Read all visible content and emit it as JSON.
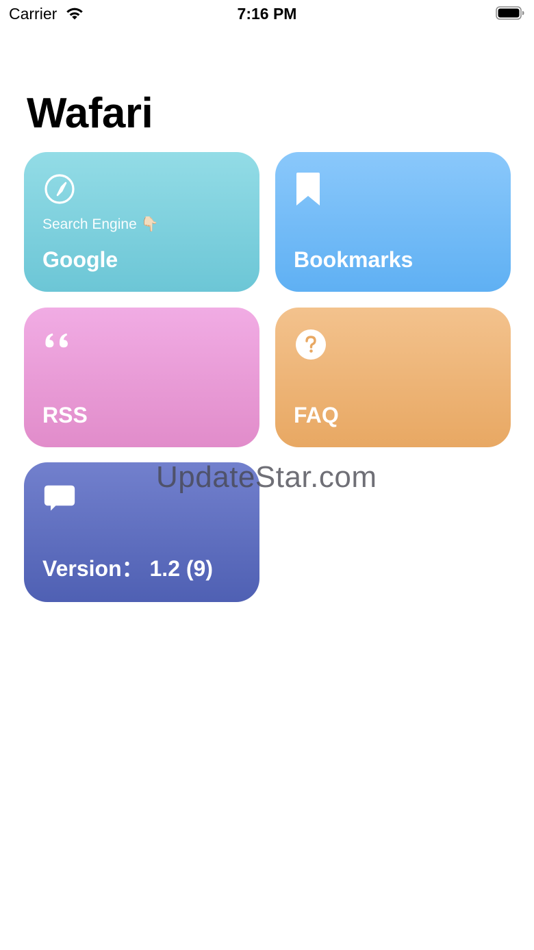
{
  "status_bar": {
    "carrier": "Carrier",
    "time": "7:16 PM",
    "wifi_icon": "wifi-icon",
    "battery_icon": "battery-icon"
  },
  "page": {
    "title": "Wafari"
  },
  "cards": {
    "google": {
      "icon": "compass-icon",
      "subtitle": "Search Engine 👇🏻",
      "label": "Google",
      "color_top": "#93dce6",
      "color_bottom": "#6cc6d6"
    },
    "bookmarks": {
      "icon": "bookmark-icon",
      "label": "Bookmarks",
      "color_top": "#8ac8fb",
      "color_bottom": "#5fb0f3"
    },
    "rss": {
      "icon": "quote-icon",
      "label": "RSS",
      "color_top": "#f1ace4",
      "color_bottom": "#e18cca"
    },
    "faq": {
      "icon": "question-circle-icon",
      "label": "FAQ",
      "color_top": "#f3c28d",
      "color_bottom": "#e8a863"
    },
    "version": {
      "icon": "chat-bubble-icon",
      "label": "Version： 1.2 (9)",
      "color_top": "#7280cd",
      "color_bottom": "#4f60b3"
    }
  },
  "watermark": "UpdateStar.com"
}
